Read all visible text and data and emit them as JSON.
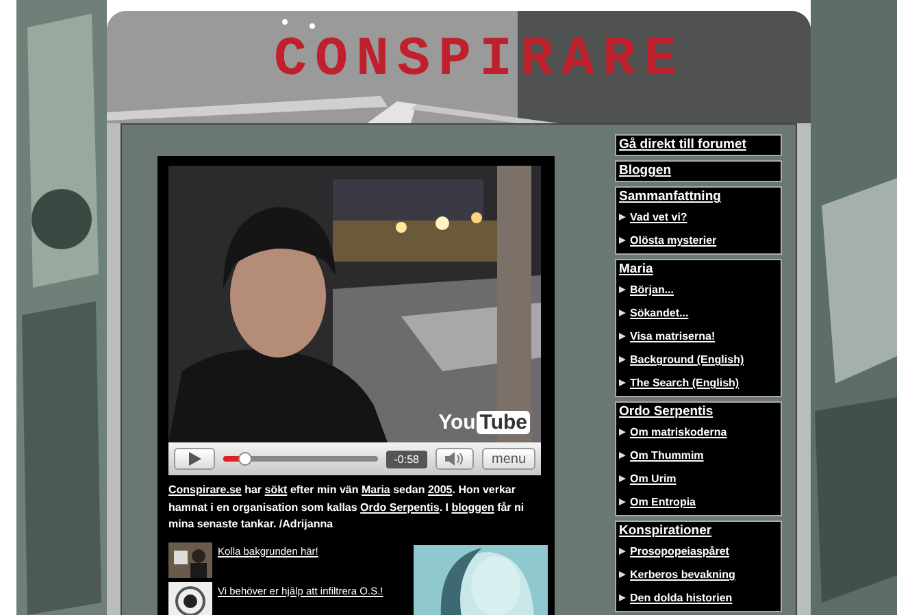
{
  "header": {
    "title": "CONSPIRARE"
  },
  "video": {
    "logo": [
      "You",
      "Tube"
    ],
    "level": 0.14,
    "time": "-0:58",
    "menu": "menu"
  },
  "intro": [
    {
      "text": "Conspirare.se",
      "link": true
    },
    {
      "text": " har ",
      "link": false
    },
    {
      "text": "sökt",
      "link": true
    },
    {
      "text": " efter min vän ",
      "link": false
    },
    {
      "text": "Maria",
      "link": true
    },
    {
      "text": " sedan ",
      "link": false
    },
    {
      "text": "2005",
      "link": true
    },
    {
      "text": ". Hon verkar hamnat i en organisation som kallas ",
      "link": false
    },
    {
      "text": "Ordo Serpentis",
      "link": true
    },
    {
      "text": ". I ",
      "link": false
    },
    {
      "text": "bloggen",
      "link": true
    },
    {
      "text": " får ni mina senaste tankar. /Adrijanna",
      "link": false
    }
  ],
  "promos": [
    {
      "label": "Kolla bakgrunden här!"
    },
    {
      "label": "Vi behöver er hjälp att infiltrera O.S.!",
      "kind": "emblem"
    }
  ],
  "sidebar": [
    {
      "title": "Gå direkt till forumet"
    },
    {
      "title": "Bloggen"
    },
    {
      "title": "Sammanfattning",
      "items": [
        "Vad vet vi?",
        "Olösta mysterier"
      ]
    },
    {
      "title": "Maria",
      "items": [
        "Början...",
        "Sökandet...",
        "Visa matriserna!",
        "Background (English)",
        "The Search (English)"
      ]
    },
    {
      "title": "Ordo Serpentis",
      "items": [
        "Om matriskoderna",
        "Om Thummim",
        "Om Urim",
        "Om Entropia"
      ]
    },
    {
      "title": "Konspirationer",
      "items": [
        "Prosopopeiaspåret",
        "Kerberos bevakning",
        "Den dolda historien"
      ]
    }
  ]
}
